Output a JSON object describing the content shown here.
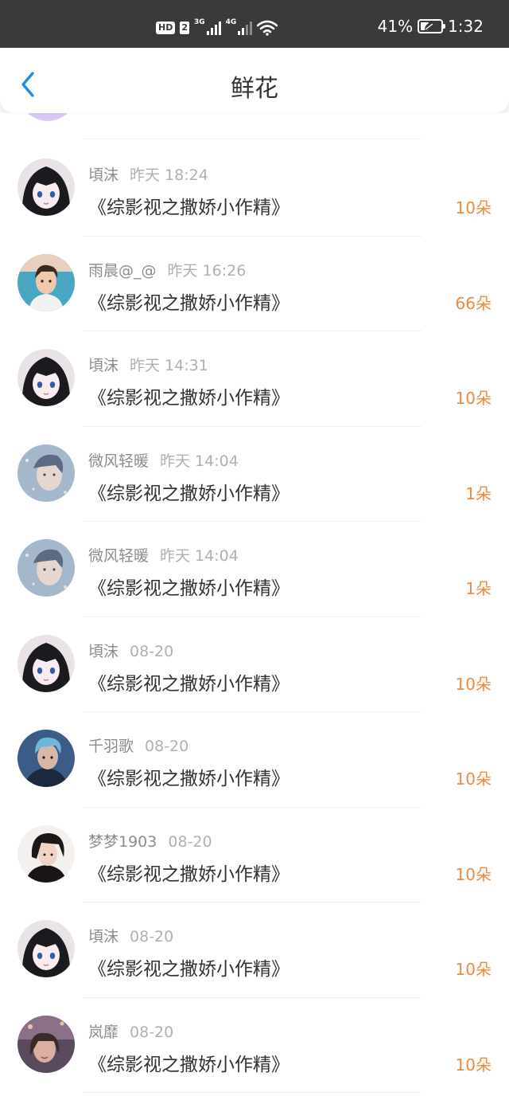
{
  "status_bar": {
    "hd": "HD",
    "sim": "2",
    "net1": "3G",
    "net2": "4G",
    "battery": "41%",
    "battery_level": 0.41,
    "time": "1:32"
  },
  "header": {
    "title": "鲜花",
    "back_icon": "chevron-left-icon"
  },
  "colors": {
    "accent": "#1f8fe6",
    "amount": "#ef8a3c"
  },
  "rows": [
    {
      "user": "頃沫",
      "time": "昨天 18:24",
      "book": "《综影视之撒娇小作精》",
      "amount": "10朵",
      "avatar": "anime-girl"
    },
    {
      "user": "雨晨@_@",
      "time": "昨天 16:26",
      "book": "《综影视之撒娇小作精》",
      "amount": "66朵",
      "avatar": "young-man"
    },
    {
      "user": "頃沫",
      "time": "昨天 14:31",
      "book": "《综影视之撒娇小作精》",
      "amount": "10朵",
      "avatar": "anime-girl"
    },
    {
      "user": "微风轻暖",
      "time": "昨天 14:04",
      "book": "《综影视之撒娇小作精》",
      "amount": "1朵",
      "avatar": "blue-portrait"
    },
    {
      "user": "微风轻暖",
      "time": "昨天 14:04",
      "book": "《综影视之撒娇小作精》",
      "amount": "1朵",
      "avatar": "blue-portrait"
    },
    {
      "user": "頃沫",
      "time": "08-20",
      "book": "《综影视之撒娇小作精》",
      "amount": "10朵",
      "avatar": "anime-girl"
    },
    {
      "user": "千羽歌",
      "time": "08-20",
      "book": "《综影视之撒娇小作精》",
      "amount": "10朵",
      "avatar": "dark-blue-portrait"
    },
    {
      "user": "梦梦1903",
      "time": "08-20",
      "book": "《综影视之撒娇小作精》",
      "amount": "10朵",
      "avatar": "dark-hair-man"
    },
    {
      "user": "頃沫",
      "time": "08-20",
      "book": "《综影视之撒娇小作精》",
      "amount": "10朵",
      "avatar": "anime-girl"
    },
    {
      "user": "岚靡",
      "time": "08-20",
      "book": "《综影视之撒娇小作精》",
      "amount": "10朵",
      "avatar": "warm-portrait"
    }
  ]
}
